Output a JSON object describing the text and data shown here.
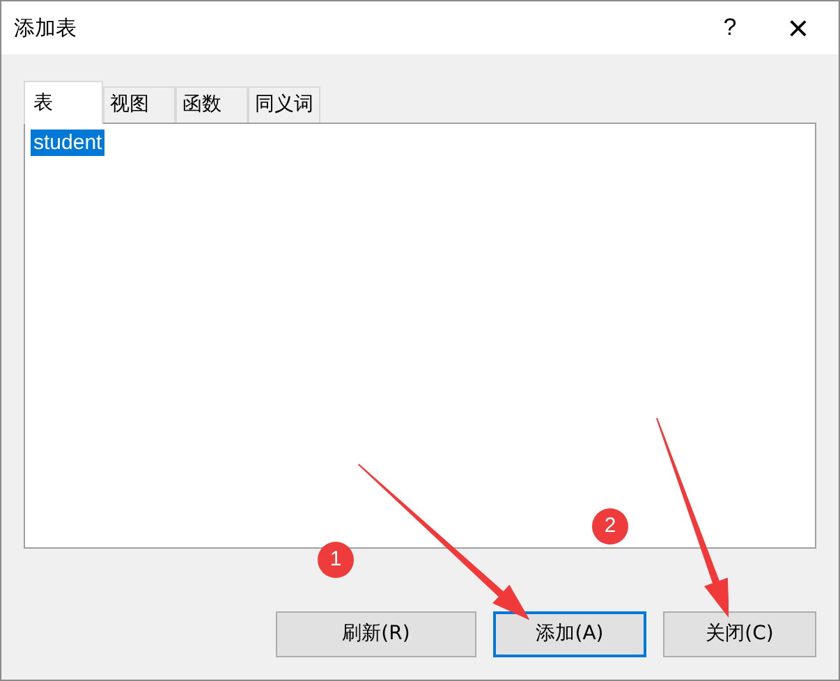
{
  "window": {
    "title": "添加表",
    "help": "?",
    "close": "×"
  },
  "tabs": [
    {
      "label": "表",
      "selected": true
    },
    {
      "label": "视图",
      "selected": false
    },
    {
      "label": "函数",
      "selected": false
    },
    {
      "label": "同义词",
      "selected": false
    }
  ],
  "list": {
    "items": [
      {
        "label": "student",
        "selected": true
      }
    ]
  },
  "buttons": [
    {
      "label": "刷新(R)",
      "focused": false
    },
    {
      "label": "添加(A)",
      "focused": true
    },
    {
      "label": "关闭(C)",
      "focused": false
    }
  ],
  "annotations": [
    {
      "kind": "arrow"
    },
    {
      "kind": "arrow"
    },
    {
      "kind": "badge",
      "label": "1"
    },
    {
      "kind": "badge",
      "label": "2"
    }
  ]
}
